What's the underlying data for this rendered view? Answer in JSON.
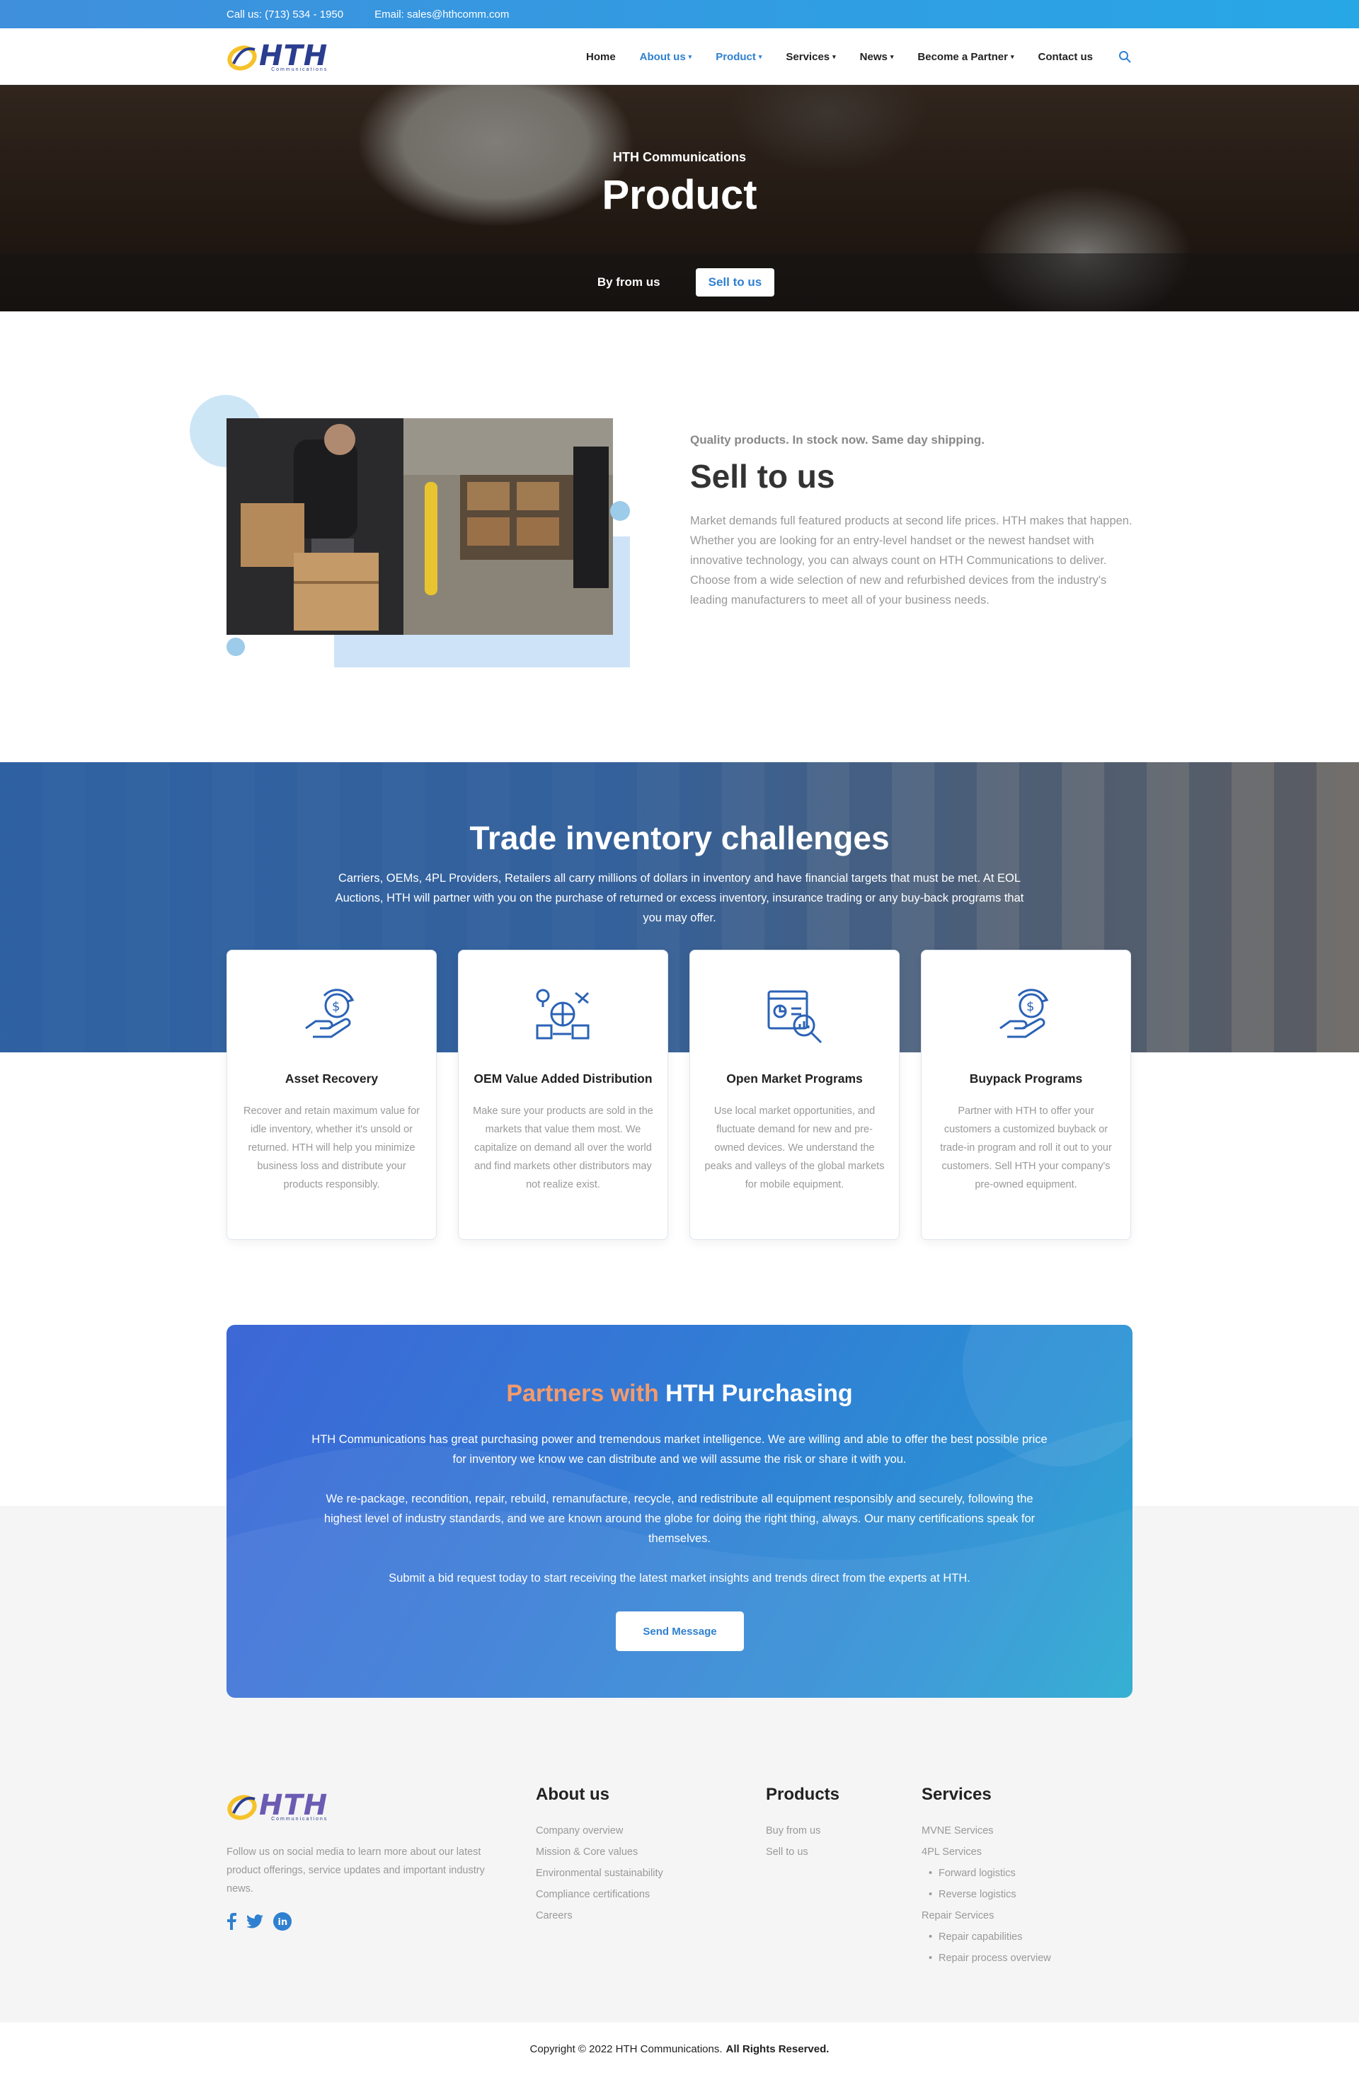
{
  "topbar": {
    "phone": "Call us: (713) 534 - 1950",
    "email": "Email: sales@hthcomm.com"
  },
  "brand": {
    "name": "HTH",
    "tagline": "Communications",
    "blue": "#2a3d8f",
    "yellow": "#f5c229"
  },
  "nav": {
    "items": [
      {
        "label": "Home",
        "caret": false,
        "color": "#222222"
      },
      {
        "label": "About us",
        "caret": true,
        "color": "#2f80d0"
      },
      {
        "label": "Product",
        "caret": true,
        "color": "#2f80d0"
      },
      {
        "label": "Services",
        "caret": true,
        "color": "#222222"
      },
      {
        "label": "News",
        "caret": true,
        "color": "#222222"
      },
      {
        "label": "Become a Partner",
        "caret": true,
        "color": "#222222"
      },
      {
        "label": "Contact us",
        "caret": false,
        "color": "#222222"
      }
    ],
    "search_icon": "search-icon"
  },
  "hero": {
    "kicker": "HTH Communications",
    "title": "Product",
    "tabs": [
      {
        "label": "By from us",
        "active": false
      },
      {
        "label": "Sell to us",
        "active": true
      }
    ]
  },
  "sell": {
    "kicker": "Quality products. In stock now. Same day shipping.",
    "title": "Sell to us",
    "body": "Market demands full featured products at second life prices. HTH makes that happen. Whether you are looking for an entry-level handset or the newest handset with innovative technology, you can always count on HTH Communications to deliver. Choose from a wide selection of new and refurbished devices from the industry's leading manufacturers to meet all of your business needs."
  },
  "trade": {
    "title": "Trade inventory challenges",
    "body": "Carriers, OEMs, 4PL Providers, Retailers all carry millions of dollars in inventory and have financial targets that must be met. At EOL Auctions, HTH will partner with you on the purchase of returned or excess inventory, insurance trading or any buy-back programs that you may offer.",
    "cards": [
      {
        "title": "Asset Recovery",
        "icon": "hand-dollar-icon",
        "body": "Recover and retain maximum value for idle inventory, whether it's unsold or returned. HTH will help you minimize business loss and distribute your products responsibly."
      },
      {
        "title": "OEM Value Added Distribution",
        "icon": "global-distribution-icon",
        "body": "Make sure your products are sold in the markets that value them most. We capitalize on demand all over the world and find markets other distributors may not realize exist."
      },
      {
        "title": "Open Market Programs",
        "icon": "market-analysis-icon",
        "body": "Use local market opportunities, and fluctuate demand for new and pre-owned devices. We understand the peaks and valleys of the global markets for mobile equipment."
      },
      {
        "title": "Buypack Programs",
        "icon": "hand-dollar-icon",
        "body": "Partner with HTH to offer your customers a customized buyback or trade-in program and roll it out to your customers. Sell HTH your company's pre-owned equipment."
      }
    ]
  },
  "partners": {
    "title_accent": "Partners with",
    "title_main": "HTH Purchasing",
    "accent_color": "#f49b6b",
    "p1": "HTH Communications has great purchasing power and tremendous market intelligence. We are willing and able to offer the best possible price for inventory we know we can distribute and we will assume the risk or share it with you.",
    "p2": "We re-package, recondition, repair, rebuild, remanufacture, recycle, and redistribute all equipment responsibly and securely, following the highest level of industry standards, and we are known around the globe for doing the right thing, always. Our many certifications speak for themselves.",
    "p3": "Submit a bid request today to start receiving the latest market insights and trends direct from the experts at HTH.",
    "button": "Send Message"
  },
  "footer": {
    "desc": "Follow us on social media to learn more about our latest product offerings, service updates and important industry news.",
    "social": [
      "facebook-icon",
      "twitter-icon",
      "linkedin-icon"
    ],
    "about": {
      "title": "About us",
      "links": [
        "Company overview",
        "Mission & Core values",
        "Environmental sustainability",
        "Compliance certifications",
        "Careers"
      ]
    },
    "products": {
      "title": "Products",
      "links": [
        "Buy from us",
        "Sell to us"
      ]
    },
    "services": {
      "title": "Services",
      "links": [
        {
          "label": "MVNE Services",
          "sub": false
        },
        {
          "label": "4PL Services",
          "sub": false
        },
        {
          "label": "Forward logistics",
          "sub": true
        },
        {
          "label": "Reverse logistics",
          "sub": true
        },
        {
          "label": "Repair Services",
          "sub": false
        },
        {
          "label": "Repair capabilities",
          "sub": true
        },
        {
          "label": "Repair process overview",
          "sub": true
        }
      ]
    },
    "copyright": "Copyright © 2022 HTH Communications.",
    "rights": "All Rights Reserved."
  }
}
